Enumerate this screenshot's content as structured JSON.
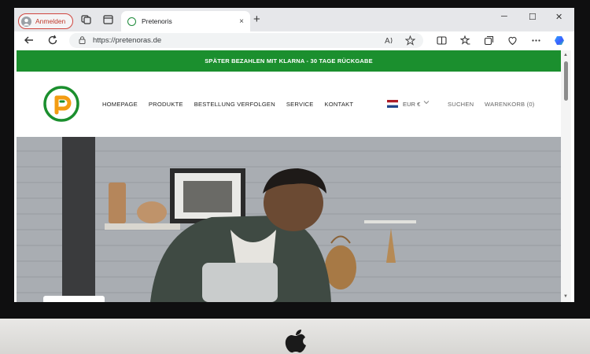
{
  "browser": {
    "profile_label": "Anmelden",
    "tab_title": "Pretenoris",
    "url": "https://pretenoras.de",
    "new_tab_glyph": "+",
    "close_tab_glyph": "×",
    "window_controls": [
      "─",
      "☐",
      "✕"
    ]
  },
  "site": {
    "promo_text": "SPÄTER BEZAHLEN MIT KLARNA - 30 TAGE RÜCKGABE",
    "nav": [
      "HOMEPAGE",
      "PRODUKTE",
      "BESTELLUNG VERFOLGEN",
      "SERVICE",
      "KONTAKT"
    ],
    "currency": "EUR €",
    "search_label": "SUCHEN",
    "cart_label": "WARENKORB (0)",
    "logo_letter": "P"
  },
  "colors": {
    "brand_green": "#1b8f2e",
    "logo_orange": "#f39c12",
    "profile_red": "#d0453f"
  },
  "icons": [
    "profile-avatar-icon",
    "workspaces-icon",
    "tab-actions-icon",
    "back-icon",
    "refresh-icon",
    "lock-icon",
    "read-aloud-icon",
    "favorite-star-icon",
    "split-screen-icon",
    "favorites-icon",
    "collections-icon",
    "browser-essentials-icon",
    "more-icon",
    "copilot-icon",
    "flag-icon",
    "apple-logo-icon"
  ]
}
